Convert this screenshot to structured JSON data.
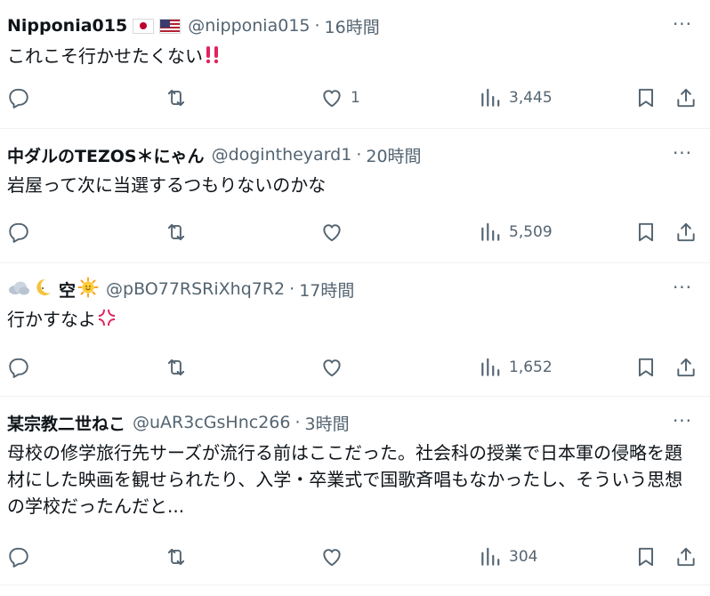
{
  "colors": {
    "text": "#0f1419",
    "muted": "#536471",
    "divider": "#eff3f4",
    "emphasis_red": "#e0245e"
  },
  "tweets": [
    {
      "name": "Nipponia015",
      "handle": "@nipponia015",
      "separator": "·",
      "time": "16時間",
      "text": "これこそ行かせたくない",
      "text_emoji": "double-exclamation-icon",
      "name_icons": [
        "flag-japan-icon",
        "flag-usa-icon"
      ],
      "replies": "",
      "retweets": "",
      "likes": "1",
      "views": "3,445"
    },
    {
      "name": "中ダルのTEZOS＊にゃん",
      "handle": "@dogintheyard1",
      "separator": "·",
      "time": "20時間",
      "text": "岩屋って次に当選するつもりないのかな",
      "replies": "",
      "retweets": "",
      "likes": "",
      "views": "5,509"
    },
    {
      "name_prefix_icons": [
        "cloud-icon",
        "crescent-moon-icon"
      ],
      "name": "空",
      "name_suffix_icons": [
        "sun-face-icon"
      ],
      "handle": "@pBO77RSRiXhq7R2",
      "separator": "·",
      "time": "17時間",
      "text": "行かすなよ",
      "text_emoji": "anger-symbol-icon",
      "replies": "",
      "retweets": "",
      "likes": "",
      "views": "1,652"
    },
    {
      "name": "某宗教二世ねこ",
      "handle": "@uAR3cGsHnc266",
      "separator": "·",
      "time": "3時間",
      "text": "母校の修学旅行先サーズが流行る前はここだった。社会科の授業で日本軍の侵略を題材にした映画を観せられたり、入学・卒業式で国歌斉唱もなかったし、そういう思想の学校だったんだと...",
      "replies": "",
      "retweets": "",
      "likes": "",
      "views": "304"
    }
  ],
  "more_label": "···"
}
